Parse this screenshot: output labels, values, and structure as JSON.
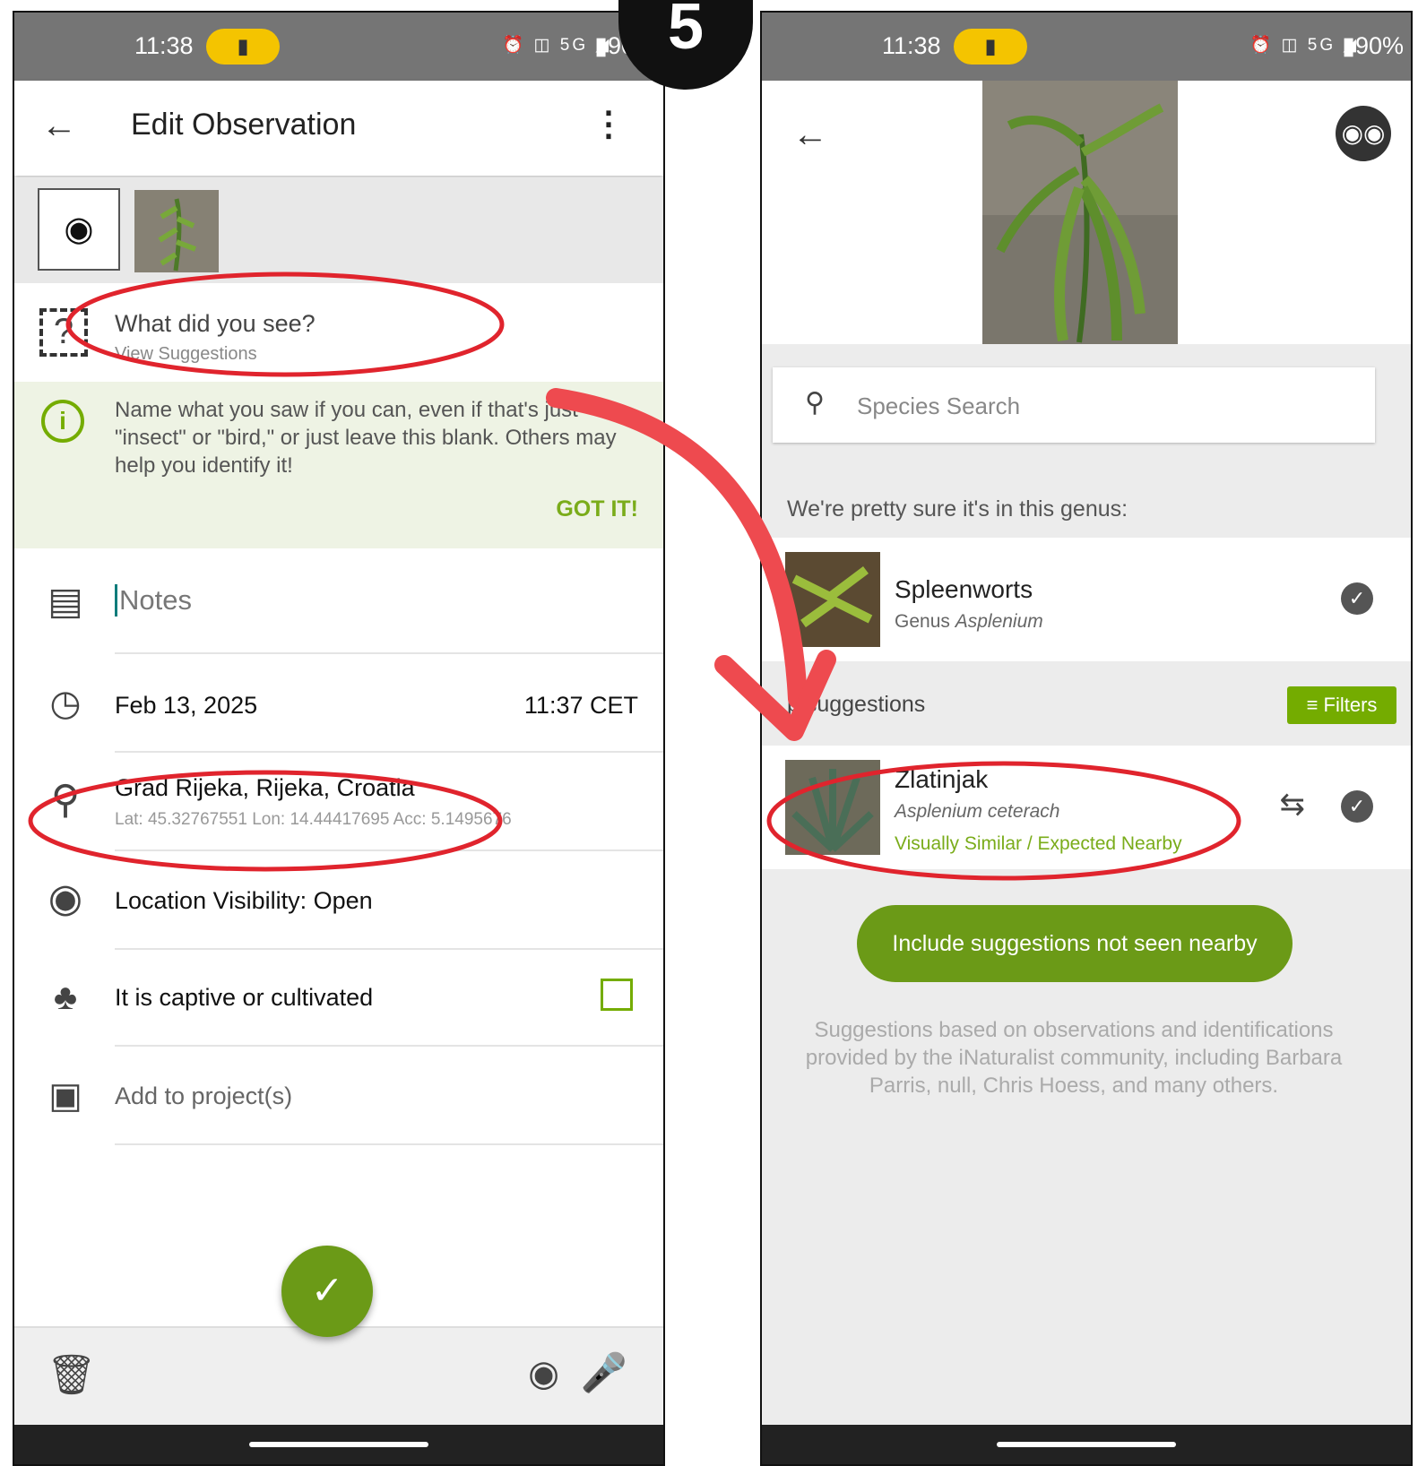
{
  "step_number": "5",
  "left_screen": {
    "status_bar": {
      "time": "11:38",
      "battery": "90%",
      "network": "5G"
    },
    "app_bar": {
      "title": "Edit Observation"
    },
    "taxon_row": {
      "title": "What did you see?",
      "subtitle": "View Suggestions"
    },
    "help_box": {
      "text": "Name what you saw if you can, even if that's just \"insect\" or \"bird,\" or just leave this blank. Others may help you identify it!",
      "dismiss_label": "GOT IT!"
    },
    "notes_row": {
      "placeholder": "Notes"
    },
    "date_row": {
      "date": "Feb 13, 2025",
      "time": "11:37 CET"
    },
    "location_row": {
      "place": "Grad Rijeka, Rijeka, Croatia",
      "coords": "Lat: 45.32767551  Lon: 14.44417695  Acc: 5.1495676"
    },
    "visibility_row": {
      "label": "Location Visibility: Open"
    },
    "captive_row": {
      "label": "It is captive or cultivated"
    },
    "project_row": {
      "label": "Add to project(s)"
    },
    "icons": {
      "back": "arrow-back-icon",
      "menu": "kebab-menu-icon",
      "add_photo": "camera-add-icon",
      "taxon": "unknown-species-icon",
      "info": "info-icon",
      "notes": "clipboard-icon",
      "date": "clock-icon",
      "location": "map-pin-icon",
      "visibility": "globe-icon",
      "captive": "planted-tree-icon",
      "project": "briefcase-icon",
      "delete": "trash-icon",
      "camera": "camera-icon",
      "mic": "microphone-icon",
      "save": "checkmark-icon"
    }
  },
  "right_screen": {
    "status_bar": {
      "time": "11:38",
      "battery": "90%",
      "network": "5G"
    },
    "search": {
      "placeholder": "Species Search"
    },
    "genus_section": {
      "label": "We're pretty sure it's in this genus:"
    },
    "genus_card": {
      "common_name": "Spleenworts",
      "rank_prefix": "Genus",
      "scientific_name": "Asplenium"
    },
    "top_section": {
      "label": "p suggestions",
      "filters_label": "Filters"
    },
    "suggestion_card": {
      "common_name": "Zlatinjak",
      "scientific_name": "Asplenium ceterach",
      "tag": "Visually Similar / Expected Nearby"
    },
    "include_button": {
      "label": "Include suggestions not seen nearby"
    },
    "credits": "Suggestions based on observations and identifications provided by the iNaturalist community, including Barbara Parris, null, Chris Hoess, and many others."
  },
  "colors": {
    "brand_green": "#74ac00",
    "button_green": "#6b9a17",
    "annotation_red": "#e0242d",
    "arrow_red": "#ee4a4f",
    "status_bar": "#757575",
    "pill_yellow": "#f4c400"
  }
}
